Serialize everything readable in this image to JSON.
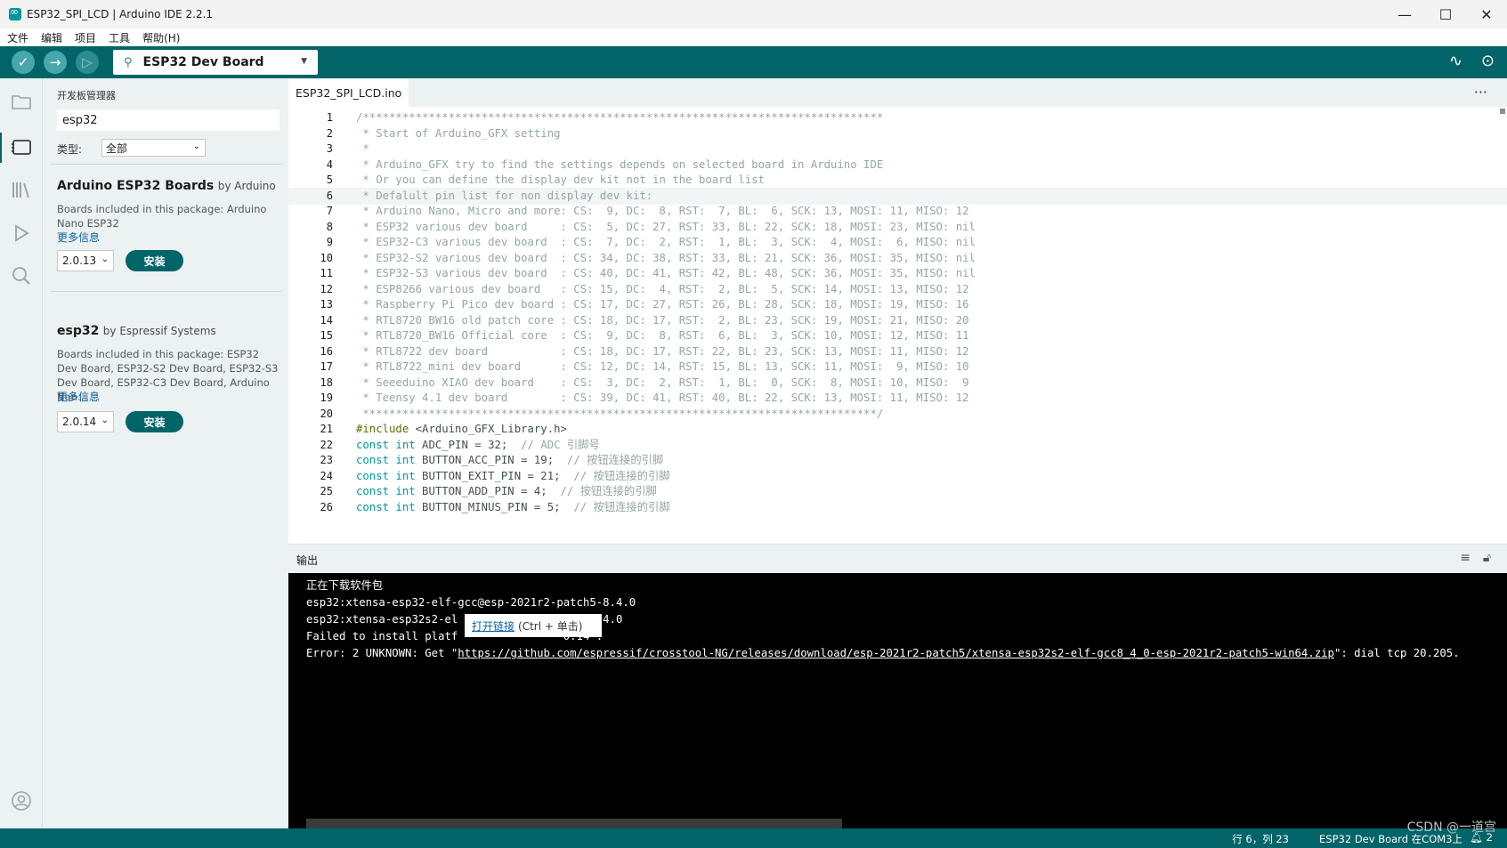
{
  "window": {
    "title": "ESP32_SPI_LCD | Arduino IDE 2.2.1",
    "minimize": "—",
    "maximize": "☐",
    "close": "✕"
  },
  "menu": [
    "文件",
    "编辑",
    "项目",
    "工具",
    "帮助(H)"
  ],
  "toolbar": {
    "board": "ESP32 Dev Board",
    "verify_icon": "✓",
    "upload_icon": "→",
    "debug_icon": "▷"
  },
  "sidebar": {
    "title": "开发板管理器",
    "search_value": "esp32",
    "type_label": "类型:",
    "type_value": "全部",
    "packages": [
      {
        "name": "Arduino ESP32 Boards",
        "by": "by Arduino",
        "desc": "Boards included in this package: Arduino Nano ESP32",
        "more": "更多信息",
        "version": "2.0.13",
        "install": "安装"
      },
      {
        "name": "esp32",
        "by": "by Espressif Systems",
        "desc": "Boards included in this package: ESP32 Dev Board, ESP32-S2 Dev Board, ESP32-S3 Dev Board, ESP32-C3 Dev Board, Arduino Nan...",
        "more": "更多信息",
        "version": "2.0.14",
        "install": "安装"
      }
    ]
  },
  "editor": {
    "tab": "ESP32_SPI_LCD.ino",
    "more_icon": "···",
    "highlighted_line": 6,
    "lines": [
      {
        "n": "1",
        "t": "/*******************************************************************************"
      },
      {
        "n": "2",
        "t": " * Start of Arduino_GFX setting"
      },
      {
        "n": "3",
        "t": " *"
      },
      {
        "n": "4",
        "t": " * Arduino_GFX try to find the settings depends on selected board in Arduino IDE"
      },
      {
        "n": "5",
        "t": " * Or you can define the display dev kit not in the board list"
      },
      {
        "n": "6",
        "t": " * Defalult pin list for non display dev kit:"
      },
      {
        "n": "7",
        "t": " * Arduino Nano, Micro and more: CS:  9, DC:  8, RST:  7, BL:  6, SCK: 13, MOSI: 11, MISO: 12"
      },
      {
        "n": "8",
        "t": " * ESP32 various dev board     : CS:  5, DC: 27, RST: 33, BL: 22, SCK: 18, MOSI: 23, MISO: nil"
      },
      {
        "n": "9",
        "t": " * ESP32-C3 various dev board  : CS:  7, DC:  2, RST:  1, BL:  3, SCK:  4, MOSI:  6, MISO: nil"
      },
      {
        "n": "10",
        "t": " * ESP32-S2 various dev board  : CS: 34, DC: 38, RST: 33, BL: 21, SCK: 36, MOSI: 35, MISO: nil"
      },
      {
        "n": "11",
        "t": " * ESP32-S3 various dev board  : CS: 40, DC: 41, RST: 42, BL: 48, SCK: 36, MOSI: 35, MISO: nil"
      },
      {
        "n": "12",
        "t": " * ESP8266 various dev board   : CS: 15, DC:  4, RST:  2, BL:  5, SCK: 14, MOSI: 13, MISO: 12"
      },
      {
        "n": "13",
        "t": " * Raspberry Pi Pico dev board : CS: 17, DC: 27, RST: 26, BL: 28, SCK: 18, MOSI: 19, MISO: 16"
      },
      {
        "n": "14",
        "t": " * RTL8720 BW16 old patch core : CS: 18, DC: 17, RST:  2, BL: 23, SCK: 19, MOSI: 21, MISO: 20"
      },
      {
        "n": "15",
        "t": " * RTL8720_BW16 Official core  : CS:  9, DC:  8, RST:  6, BL:  3, SCK: 10, MOSI: 12, MISO: 11"
      },
      {
        "n": "16",
        "t": " * RTL8722 dev board           : CS: 18, DC: 17, RST: 22, BL: 23, SCK: 13, MOSI: 11, MISO: 12"
      },
      {
        "n": "17",
        "t": " * RTL8722_mini dev board      : CS: 12, DC: 14, RST: 15, BL: 13, SCK: 11, MOSI:  9, MISO: 10"
      },
      {
        "n": "18",
        "t": " * Seeeduino XIAO dev board    : CS:  3, DC:  2, RST:  1, BL:  0, SCK:  8, MOSI: 10, MISO:  9"
      },
      {
        "n": "19",
        "t": " * Teensy 4.1 dev board        : CS: 39, DC: 41, RST: 40, BL: 22, SCK: 13, MOSI: 11, MISO: 12"
      },
      {
        "n": "20",
        "t": " ******************************************************************************/"
      },
      {
        "n": "21",
        "pp": "#include",
        "t": " <Arduino_GFX_Library.h>"
      },
      {
        "n": "22",
        "kw": "const int",
        "t": " ADC_PIN = 32;  ",
        "cm": "// ADC 引脚号"
      },
      {
        "n": "23",
        "kw": "const int",
        "t": " BUTTON_ACC_PIN = 19;  ",
        "cm": "// 按钮连接的引脚"
      },
      {
        "n": "24",
        "kw": "const int",
        "t": " BUTTON_EXIT_PIN = 21;  ",
        "cm": "// 按钮连接的引脚"
      },
      {
        "n": "25",
        "kw": "const int",
        "t": " BUTTON_ADD_PIN = 4;  ",
        "cm": "// 按钮连接的引脚"
      },
      {
        "n": "26",
        "kw": "const int",
        "t": " BUTTON_MINUS_PIN = 5;  ",
        "cm": "// 按钮连接的引脚"
      }
    ]
  },
  "output": {
    "title": "输出",
    "lines": [
      "正在下载软件包",
      "esp32:xtensa-esp32-elf-gcc@esp-2021r2-patch5-8.4.0",
      "esp32:xtensa-esp32s2-el                ch5-8.4.0",
      "Failed to install platf                0.14'."
    ],
    "error_prefix": "Error: 2 UNKNOWN: Get \"",
    "error_link": "https://github.com/espressif/crosstool-NG/releases/download/esp-2021r2-patch5/xtensa-esp32s2-elf-gcc8_4_0-esp-2021r2-patch5-win64.zip",
    "error_suffix": "\": dial tcp 20.205.",
    "tooltip_link": "打开链接",
    "tooltip_hint": "(Ctrl + 单击)"
  },
  "status": {
    "position": "行 6，列 23",
    "board": "ESP32 Dev Board 在COM3上",
    "notifications": "2"
  },
  "watermark": "CSDN @一道宫"
}
